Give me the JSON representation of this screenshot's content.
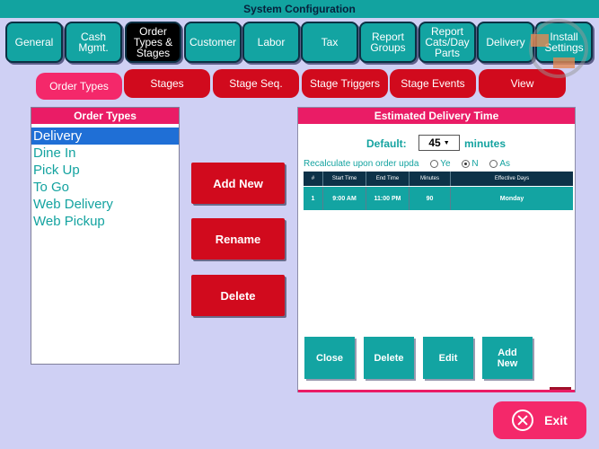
{
  "title": "System Configuration",
  "top_tabs": [
    {
      "label": "General",
      "active": false
    },
    {
      "label": "Cash\nMgmt.",
      "active": false
    },
    {
      "label": "Order\nTypes &\nStages",
      "active": true
    },
    {
      "label": "Customer",
      "active": false
    },
    {
      "label": "Labor",
      "active": false
    },
    {
      "label": "Tax",
      "active": false
    },
    {
      "label": "Report\nGroups",
      "active": false
    },
    {
      "label": "Report\nCats/Day\nParts",
      "active": false
    },
    {
      "label": "Delivery",
      "active": false
    },
    {
      "label": "Install\nSettings",
      "active": false
    }
  ],
  "sub_tabs": [
    {
      "label": "Order Types",
      "active": true
    },
    {
      "label": "Stages",
      "active": false
    },
    {
      "label": "Stage Seq.",
      "active": false
    },
    {
      "label": "Stage Triggers",
      "active": false
    },
    {
      "label": "Stage Events",
      "active": false
    },
    {
      "label": "View",
      "active": false
    }
  ],
  "order_types": {
    "header": "Order Types",
    "items": [
      "Delivery",
      "Dine In",
      "Pick Up",
      "To Go",
      "Web Delivery",
      "Web Pickup"
    ],
    "selected": "Delivery"
  },
  "actions": {
    "add_new": "Add New",
    "rename": "Rename",
    "delete": "Delete"
  },
  "delivery_time": {
    "header": "Estimated Delivery Time",
    "default_label": "Default:",
    "default_value": "45",
    "units": "minutes",
    "recalc_label": "Recalculate upon order upda",
    "recalc_options": [
      "Ye",
      "N",
      "As"
    ],
    "recalc_selected": "N",
    "columns": [
      "#",
      "Start Time",
      "End Time",
      "Minutes",
      "Effective Days"
    ],
    "rows": [
      {
        "num": "1",
        "start": "9:00 AM",
        "end": "11:00 PM",
        "minutes": "90",
        "days": "Monday"
      }
    ],
    "buttons": {
      "close": "Close",
      "delete": "Delete",
      "edit": "Edit",
      "add_new": "Add\nNew"
    }
  },
  "exit_label": "Exit"
}
